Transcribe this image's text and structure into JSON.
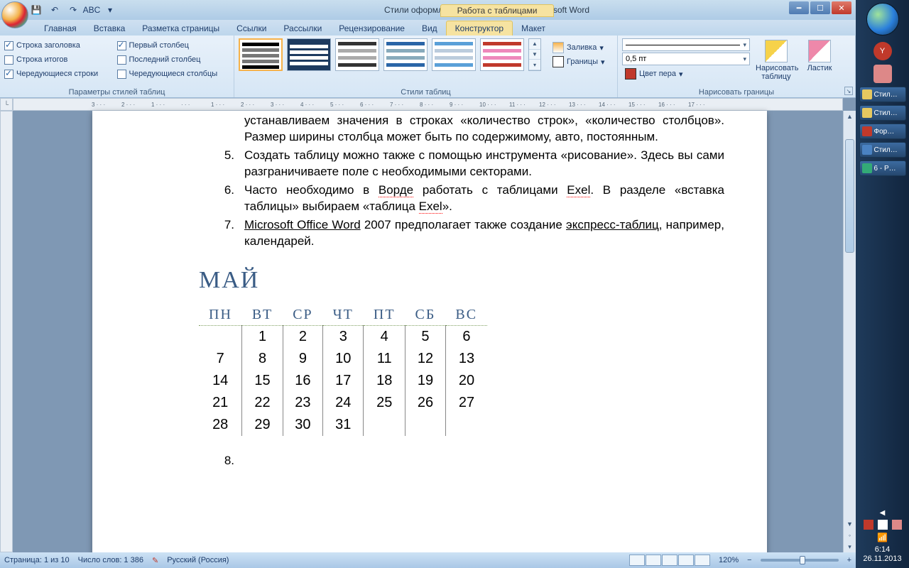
{
  "titlebar": {
    "doc_title": "Стили оформления таблиц в ворде - Microsoft Word",
    "context_tab": "Работа с таблицами"
  },
  "qat": {
    "save": "💾",
    "undo": "↶",
    "redo": "↷",
    "spell": "ABC"
  },
  "tabs": [
    "Главная",
    "Вставка",
    "Разметка страницы",
    "Ссылки",
    "Рассылки",
    "Рецензирование",
    "Вид",
    "Конструктор",
    "Макет"
  ],
  "active_tab_index": 7,
  "ribbon": {
    "group1_label": "Параметры стилей таблиц",
    "opts_left": [
      {
        "label": "Строка заголовка",
        "checked": true
      },
      {
        "label": "Строка итогов",
        "checked": false
      },
      {
        "label": "Чередующиеся строки",
        "checked": true
      }
    ],
    "opts_right": [
      {
        "label": "Первый столбец",
        "checked": true
      },
      {
        "label": "Последний столбец",
        "checked": false
      },
      {
        "label": "Чередующиеся столбцы",
        "checked": false
      }
    ],
    "group2_label": "Стили таблиц",
    "shading_label": "Заливка",
    "borders_label": "Границы",
    "group3_label": "Нарисовать границы",
    "pen_width": "0,5 пт",
    "pen_color_label": "Цвет пера",
    "draw_label": "Нарисовать таблицу",
    "eraser_label": "Ластик"
  },
  "ruler_h": [
    "3",
    "2",
    "1",
    "",
    "1",
    "2",
    "3",
    "4",
    "5",
    "6",
    "7",
    "8",
    "9",
    "10",
    "11",
    "12",
    "13",
    "14",
    "15",
    "16",
    "17"
  ],
  "doc": {
    "line_top": "устанавливаем значения в строках «количество строк», «количество столбцов». Размер ширины столбца может быть по содержимому, авто, постоянным.",
    "li5": "Создать таблицу можно также с помощью инструмента «рисование». Здесь вы сами разграничиваете поле с необходимыми секторами.",
    "li6_a": "Часто необходимо в ",
    "li6_b": "Ворде",
    "li6_c": " работать с таблицами ",
    "li6_d": "Exel",
    "li6_e": ". В разделе «вставка таблицы» выбираем «таблица ",
    "li6_f": "Exel",
    "li6_g": "».",
    "li7_a": "Microsoft Office Word",
    "li7_b": " 2007 предполагает также создание ",
    "li7_c": "экспресс-таблиц",
    "li7_d": ", например, календарей.",
    "cal_title": "МАЙ",
    "days": [
      "ПН",
      "ВТ",
      "СР",
      "ЧТ",
      "ПТ",
      "СБ",
      "ВС"
    ],
    "weeks": [
      [
        "",
        "1",
        "2",
        "3",
        "4",
        "5",
        "6"
      ],
      [
        "7",
        "8",
        "9",
        "10",
        "11",
        "12",
        "13"
      ],
      [
        "14",
        "15",
        "16",
        "17",
        "18",
        "19",
        "20"
      ],
      [
        "21",
        "22",
        "23",
        "24",
        "25",
        "26",
        "27"
      ],
      [
        "28",
        "29",
        "30",
        "31",
        "",
        "",
        ""
      ]
    ],
    "li8_num": "8."
  },
  "status": {
    "page": "Страница: 1 из 10",
    "words": "Число слов: 1 386",
    "lang": "Русский (Россия)",
    "zoom": "120%"
  },
  "taskbar": {
    "items": [
      "Стил…",
      "Стил…",
      "Фор…",
      "Стил…",
      "6 - P…"
    ],
    "time": "6:14",
    "date": "26.11.2013"
  }
}
